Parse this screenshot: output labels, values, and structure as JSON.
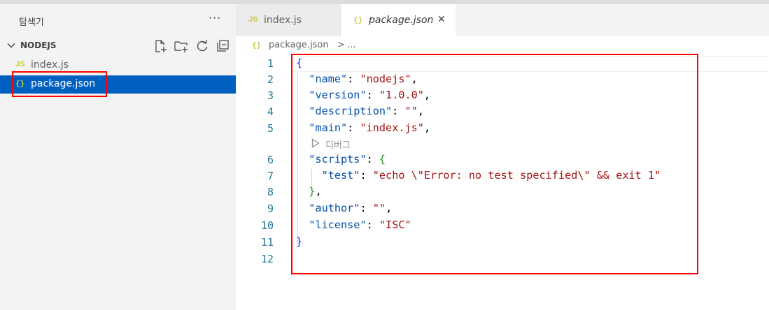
{
  "explorer": {
    "title": "탐색기",
    "more_label": "···",
    "folder": "NODEJS",
    "files": [
      {
        "icon": "JS",
        "name": "index.js"
      },
      {
        "icon": "{}",
        "name": "package.json"
      }
    ]
  },
  "tabs": [
    {
      "icon": "JS",
      "label": "index.js"
    },
    {
      "icon": "{}",
      "label": "package.json",
      "close": "✕"
    }
  ],
  "breadcrumb": {
    "icon": "{}",
    "file": "package.json",
    "sep": ">",
    "more": "..."
  },
  "editor": {
    "line_numbers": [
      "1",
      "2",
      "3",
      "4",
      "5",
      "6",
      "7",
      "8",
      "9",
      "10",
      "11",
      "12"
    ],
    "codelens": "디버그",
    "json": {
      "name": "nodejs",
      "version": "1.0.0",
      "description": "",
      "main": "index.js",
      "test_script": "echo \\\"Error: no test specified\\\" && exit 1",
      "author": "",
      "license": "ISC"
    }
  },
  "colors": {
    "selection": "#0060c0",
    "highlight_box": "#ff0000",
    "json_key": "#0451a5",
    "json_string": "#a31515"
  }
}
